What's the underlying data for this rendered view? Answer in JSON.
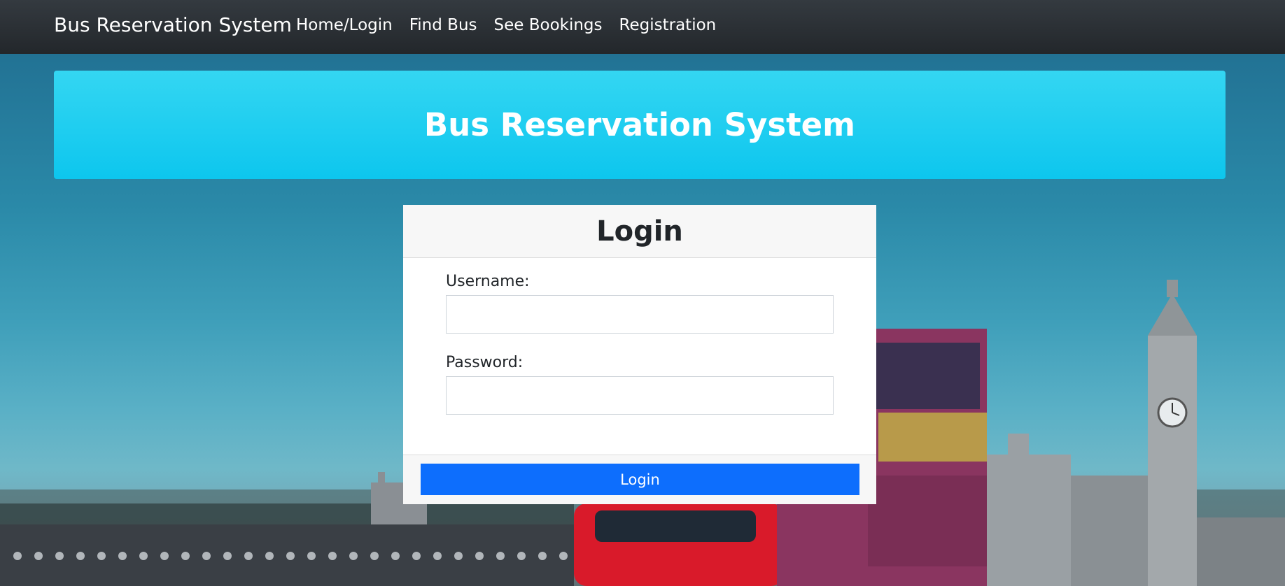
{
  "navbar": {
    "brand": "Bus Reservation System",
    "links": [
      {
        "label": "Home/Login"
      },
      {
        "label": "Find Bus"
      },
      {
        "label": "See Bookings"
      },
      {
        "label": "Registration"
      }
    ]
  },
  "banner": {
    "title": "Bus Reservation System"
  },
  "login_card": {
    "title": "Login",
    "username_label": "Username:",
    "username_value": "",
    "password_label": "Password:",
    "password_value": "",
    "submit_label": "Login"
  },
  "background": {
    "description_icon": "london-bus-bigben-photo"
  },
  "colors": {
    "navbar": "#343a40",
    "banner": "#17cdee",
    "primary_button": "#0d6efd"
  }
}
